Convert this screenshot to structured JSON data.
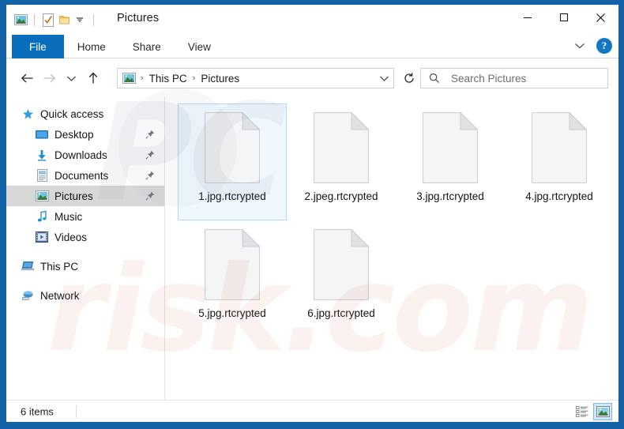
{
  "window": {
    "title": "Pictures",
    "quick_access_icons": [
      "picture-icon",
      "properties-checkbox-icon",
      "new-folder-icon",
      "customize-chevron-icon"
    ],
    "controls": [
      {
        "name": "minimize-button",
        "glyph": "─"
      },
      {
        "name": "maximize-button",
        "glyph": "□"
      },
      {
        "name": "close-button",
        "glyph": "✕"
      }
    ]
  },
  "ribbon": {
    "tabs": [
      {
        "label": "File",
        "name": "tab-file",
        "active": true
      },
      {
        "label": "Home",
        "name": "tab-home",
        "active": false
      },
      {
        "label": "Share",
        "name": "tab-share",
        "active": false
      },
      {
        "label": "View",
        "name": "tab-view",
        "active": false
      }
    ],
    "expand_icon": "chevron-down-icon",
    "help_label": "?"
  },
  "address": {
    "back_icon": "back-arrow-icon",
    "forward_icon": "forward-arrow-icon",
    "recent_icon": "chevron-down-icon",
    "up_icon": "up-arrow-icon",
    "location_icon": "picture-icon",
    "breadcrumbs": [
      "This PC",
      "Pictures"
    ],
    "separator": "›",
    "dropdown_icon": "chevron-down-icon",
    "refresh_icon": "refresh-icon"
  },
  "search": {
    "icon": "search-icon",
    "placeholder": "Search Pictures",
    "value": ""
  },
  "sidebar": {
    "items": [
      {
        "label": "Quick access",
        "icon": "star-icon",
        "level": "root",
        "pinned": false,
        "selected": false
      },
      {
        "label": "Desktop",
        "icon": "desktop-icon",
        "level": "child",
        "pinned": true,
        "selected": false
      },
      {
        "label": "Downloads",
        "icon": "download-icon",
        "level": "child",
        "pinned": true,
        "selected": false
      },
      {
        "label": "Documents",
        "icon": "documents-icon",
        "level": "child",
        "pinned": true,
        "selected": false
      },
      {
        "label": "Pictures",
        "icon": "picture-icon",
        "level": "child",
        "pinned": true,
        "selected": true
      },
      {
        "label": "Music",
        "icon": "music-note-icon",
        "level": "child",
        "pinned": false,
        "selected": false
      },
      {
        "label": "Videos",
        "icon": "video-icon",
        "level": "child",
        "pinned": false,
        "selected": false
      },
      {
        "label": "This PC",
        "icon": "computer-icon",
        "level": "root",
        "pinned": false,
        "selected": false
      },
      {
        "label": "Network",
        "icon": "network-icon",
        "level": "root",
        "pinned": false,
        "selected": false
      }
    ]
  },
  "files": [
    {
      "name": "1.jpg.rtcrypted",
      "icon": "blank-document-icon",
      "selected": true
    },
    {
      "name": "2.jpeg.rtcrypted",
      "icon": "blank-document-icon",
      "selected": false
    },
    {
      "name": "3.jpg.rtcrypted",
      "icon": "blank-document-icon",
      "selected": false
    },
    {
      "name": "4.jpg.rtcrypted",
      "icon": "blank-document-icon",
      "selected": false
    },
    {
      "name": "5.jpg.rtcrypted",
      "icon": "blank-document-icon",
      "selected": false
    },
    {
      "name": "6.jpg.rtcrypted",
      "icon": "blank-document-icon",
      "selected": false
    }
  ],
  "status": {
    "item_count": "6 items",
    "views": [
      {
        "name": "details-view-button",
        "icon": "details-view-icon",
        "active": false
      },
      {
        "name": "large-icons-view-button",
        "icon": "large-icons-view-icon",
        "active": true
      }
    ]
  },
  "watermark": {
    "line1": "PC",
    "line2": "risk.com"
  },
  "colors": {
    "frame_blue": "#1363a6",
    "file_tab_blue": "#0b6ebd",
    "selection_blue": "#cde8ff",
    "selection_border": "#b4d9f4",
    "sidebar_selected_gray": "#d8d8d8"
  }
}
